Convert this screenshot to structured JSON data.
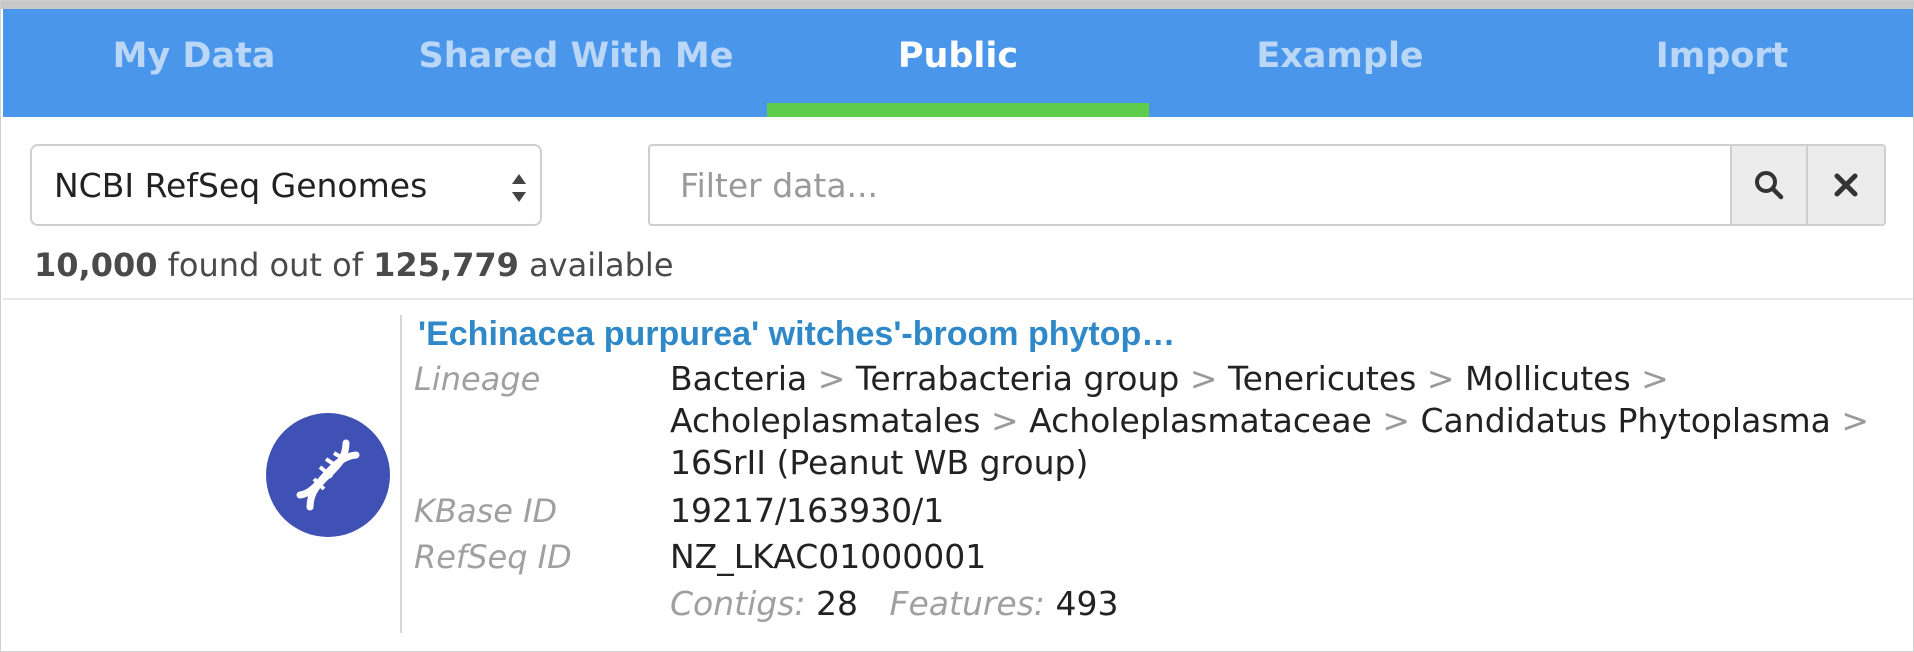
{
  "tabs": [
    {
      "label": "My Data",
      "active": false
    },
    {
      "label": "Shared With Me",
      "active": false
    },
    {
      "label": "Public",
      "active": true
    },
    {
      "label": "Example",
      "active": false
    },
    {
      "label": "Import",
      "active": false
    }
  ],
  "source_select": {
    "value": "NCBI RefSeq Genomes"
  },
  "filter": {
    "placeholder": "Filter data...",
    "search_icon": "search-icon",
    "clear_icon": "close-icon"
  },
  "results": {
    "found": "10,000",
    "found_text": "found out of",
    "available": "125,779",
    "available_text": "available"
  },
  "item": {
    "icon": "dna-icon",
    "title": "'Echinacea purpurea' witches'-broom phytop…",
    "lineage_label": "Lineage",
    "lineage": {
      "t0": "Bacteria",
      "t1": "Terrabacteria group",
      "t2": "Tenericutes",
      "t3": "Mollicutes",
      "t4": "Acholeplasmatales",
      "t5": "Acholeplasmataceae",
      "t6": "Candidatus Phytoplasma",
      "t7": "16SrII (Peanut WB group)",
      "separator": ">"
    },
    "kbase_label": "KBase ID",
    "kbase_id": "19217/163930/1",
    "refseq_label": "RefSeq ID",
    "refseq_id": "NZ_LKAC01000001",
    "contigs_label": "Contigs:",
    "contigs": "28",
    "features_label": "Features:",
    "features": "493"
  },
  "colors": {
    "tabbar": "#4a96eb",
    "active_indicator": "#5fcc4c",
    "title_link": "#2f88c8",
    "avatar": "#3f51b5"
  }
}
